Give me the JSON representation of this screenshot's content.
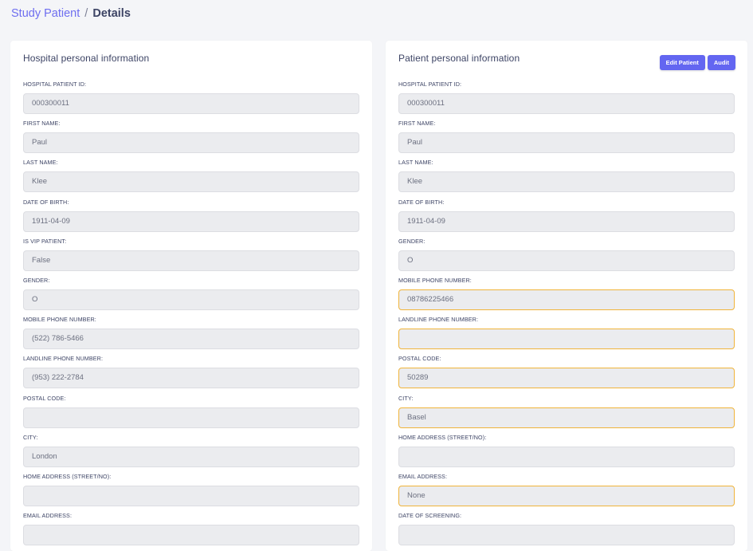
{
  "breadcrumb": {
    "parent": "Study Patient",
    "separator": "/",
    "current": "Details"
  },
  "hospital": {
    "title": "Hospital personal information",
    "fields": [
      {
        "label": "HOSPITAL PATIENT ID:",
        "value": "000300011"
      },
      {
        "label": "FIRST NAME:",
        "value": "Paul"
      },
      {
        "label": "LAST NAME:",
        "value": "Klee"
      },
      {
        "label": "DATE OF BIRTH:",
        "value": "1911-04-09"
      },
      {
        "label": "IS VIP PATIENT:",
        "value": "False"
      },
      {
        "label": "GENDER:",
        "value": "O"
      },
      {
        "label": "MOBILE PHONE NUMBER:",
        "value": "(522) 786-5466"
      },
      {
        "label": "LANDLINE PHONE NUMBER:",
        "value": "(953) 222-2784"
      },
      {
        "label": "POSTAL CODE:",
        "value": ""
      },
      {
        "label": "CITY:",
        "value": "London"
      },
      {
        "label": "HOME ADDRESS (STREET/NO):",
        "value": ""
      },
      {
        "label": "EMAIL ADDRESS:",
        "value": ""
      }
    ]
  },
  "patient": {
    "title": "Patient personal information",
    "edit_label": "Edit Patient",
    "audit_label": "Audit",
    "fields": [
      {
        "label": "HOSPITAL PATIENT ID:",
        "value": "000300011"
      },
      {
        "label": "FIRST NAME:",
        "value": "Paul"
      },
      {
        "label": "LAST NAME:",
        "value": "Klee"
      },
      {
        "label": "DATE OF BIRTH:",
        "value": "1911-04-09"
      },
      {
        "label": "GENDER:",
        "value": "O"
      },
      {
        "label": "MOBILE PHONE NUMBER:",
        "value": "08786225466"
      },
      {
        "label": "LANDLINE PHONE NUMBER:",
        "value": ""
      },
      {
        "label": "POSTAL CODE:",
        "value": "50289"
      },
      {
        "label": "CITY:",
        "value": "Basel"
      },
      {
        "label": "HOME ADDRESS (STREET/NO):",
        "value": ""
      },
      {
        "label": "EMAIL ADDRESS:",
        "value": "None"
      },
      {
        "label": "DATE OF SCREENING:",
        "value": ""
      }
    ]
  },
  "colors": {
    "accent": "#6366f1",
    "changed_border": "#f0b43a",
    "field_bg": "#ebecef"
  }
}
